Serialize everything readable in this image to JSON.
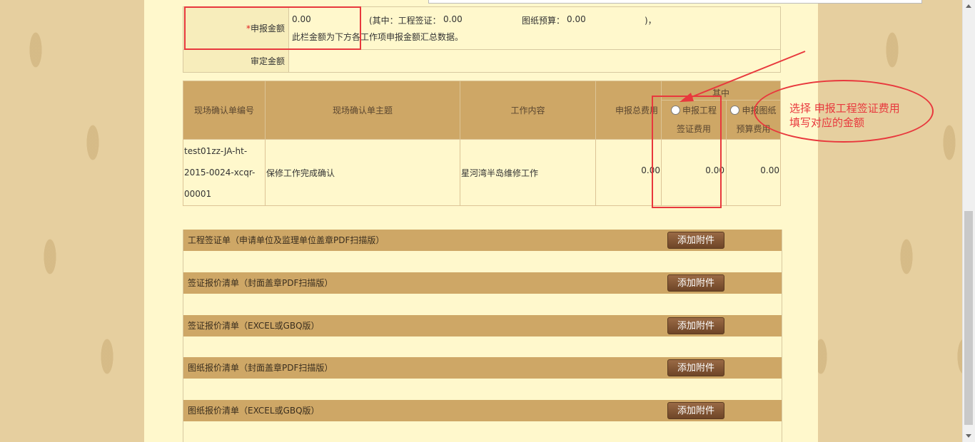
{
  "amount": {
    "label": "申报金额",
    "required_mark": "*",
    "value": "0.00",
    "breakdown_open": "(其中：工程签证：",
    "sign_value": "0.00",
    "drawing_label": "图纸预算：",
    "drawing_value": "0.00",
    "breakdown_close": ")，",
    "note": "此栏金额为下方各工作项申报金额汇总数据。"
  },
  "approved": {
    "label": "审定金额",
    "value": ""
  },
  "grid": {
    "headers": {
      "code": "现场确认单编号",
      "subject": "现场确认单主题",
      "content": "工作内容",
      "total": "申报总费用",
      "group": "其中",
      "option1_line1": "申报工程",
      "option1_line2": "签证费用",
      "option2_line1": "申报图纸",
      "option2_line2": "预算费用"
    },
    "rows": [
      {
        "code_line1": "test01zz-JA-ht-",
        "code_line2": "2015-0024-xcqr-",
        "code_line3": "00001",
        "subject": "保修工作完成确认",
        "content": "星河湾半岛维修工作",
        "total": "0.00",
        "sign_fee": "0.00",
        "drawing_fee": "0.00"
      }
    ]
  },
  "attachments": [
    {
      "label": "工程签证单（申请单位及监理单位盖章PDF扫描版）",
      "button": "添加附件"
    },
    {
      "label": "签证报价清单（封面盖章PDF扫描版）",
      "button": "添加附件"
    },
    {
      "label": "签证报价清单（EXCEL或GBQ版）",
      "button": "添加附件"
    },
    {
      "label": "图纸报价清单（封面盖章PDF扫描版）",
      "button": "添加附件"
    },
    {
      "label": "图纸报价清单（EXCEL或GBQ版）",
      "button": "添加附件"
    }
  ],
  "annotation": {
    "line1": "选择 申报工程签证费用",
    "line2": "填写对应的金额",
    "color": "#e8383d"
  }
}
